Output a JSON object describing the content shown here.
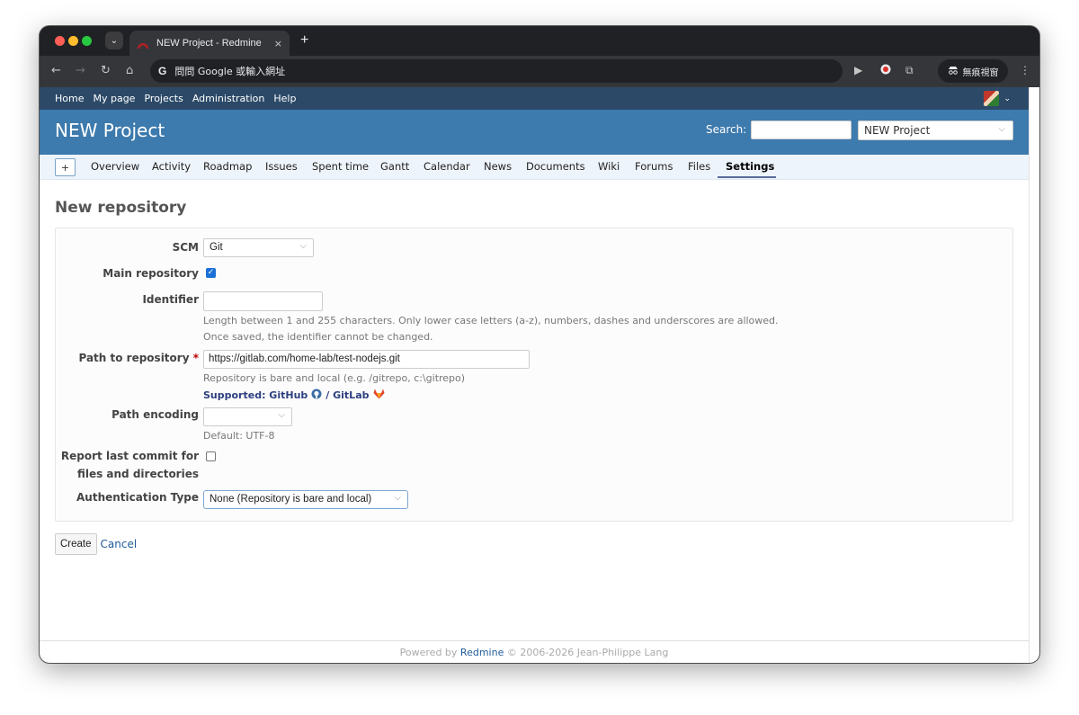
{
  "browser": {
    "tab_title": "NEW Project - Redmine",
    "tab_close": "×",
    "new_tab": "+",
    "tab_menu": "⌄",
    "address_bar": "問問 Google 或輸入網址",
    "google_letter": "G",
    "incognito_label": "無痕視窗"
  },
  "top_menu": {
    "items": [
      "Home",
      "My page",
      "Projects",
      "Administration",
      "Help"
    ]
  },
  "header": {
    "project_name": "NEW Project",
    "search_label": "Search:",
    "search_value": "",
    "project_jump": "NEW Project"
  },
  "main_menu": {
    "new_object": "+",
    "items": [
      "Overview",
      "Activity",
      "Roadmap",
      "Issues",
      "Spent time",
      "Gantt",
      "Calendar",
      "News",
      "Documents",
      "Wiki",
      "Forums",
      "Files",
      "Settings"
    ],
    "selected": "Settings"
  },
  "form": {
    "page_title": "New repository",
    "scm": {
      "label": "SCM",
      "value": "Git"
    },
    "main_repository": {
      "label": "Main repository",
      "checked": true
    },
    "identifier": {
      "label": "Identifier",
      "value": "",
      "info1": "Length between 1 and 255 characters. Only lower case letters (a-z), numbers, dashes and underscores are allowed.",
      "info2": "Once saved, the identifier cannot be changed."
    },
    "path": {
      "label": "Path to repository",
      "required": "*",
      "value": "https://gitlab.com/home-lab/test-nodejs.git",
      "info": "Repository is bare and local (e.g. /gitrepo, c:\\gitrepo)",
      "supported_prefix": "Supported: GitHub",
      "supported_sep": "/ GitLab"
    },
    "path_encoding": {
      "label": "Path encoding",
      "value": "",
      "info": "Default: UTF-8"
    },
    "report_last_commit": {
      "label_line1": "Report last commit for",
      "label_line2": "files and directories",
      "checked": false
    },
    "auth_type": {
      "label": "Authentication Type",
      "value": "None (Repository is bare and local)"
    },
    "create_button": "Create",
    "cancel_link": "Cancel"
  },
  "footer": {
    "prefix": "Powered by",
    "link": "Redmine",
    "suffix": "© 2006-2026 Jean-Philippe Lang"
  }
}
